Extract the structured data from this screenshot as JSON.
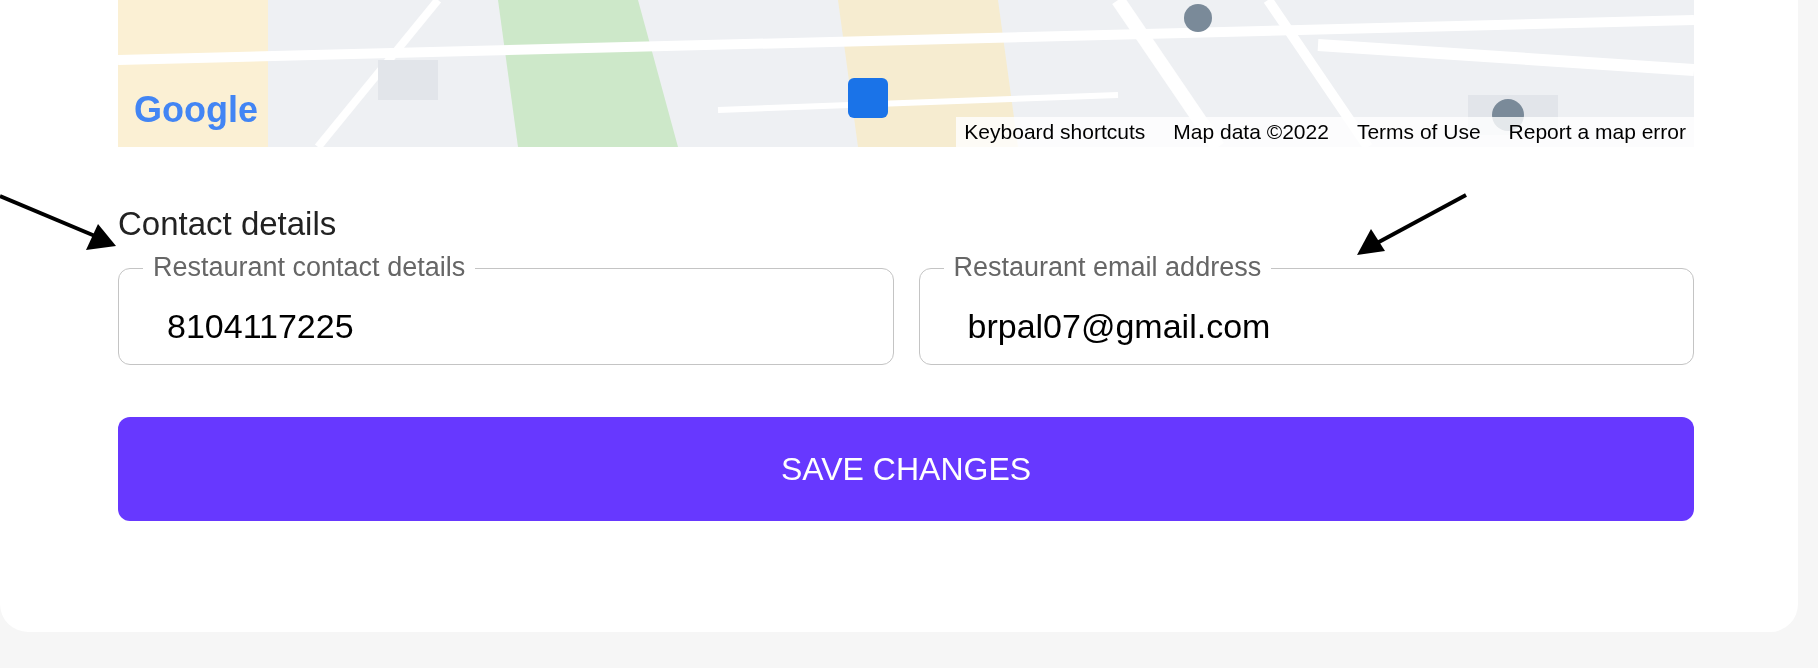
{
  "map": {
    "kind": "picture",
    "logo": "Google",
    "footer_links": [
      "Keyboard shortcuts",
      "Map data ©2022",
      "Terms of Use",
      "Report a map error"
    ]
  },
  "section": {
    "title": "Contact details"
  },
  "fields": [
    {
      "label": "Restaurant contact details",
      "value": "8104117225"
    },
    {
      "label": "Restaurant email address",
      "value": "brpal07@gmail.com"
    }
  ],
  "save_button": {
    "label": "SAVE CHANGES"
  }
}
